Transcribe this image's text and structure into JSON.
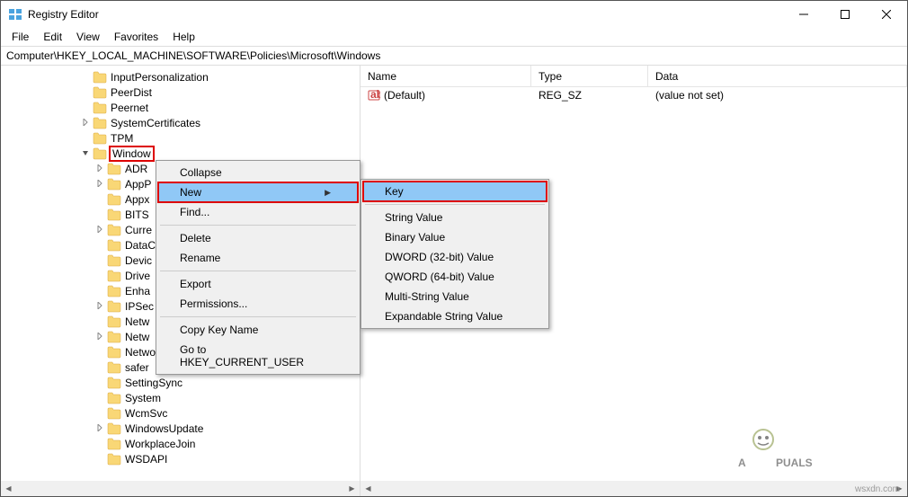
{
  "window": {
    "title": "Registry Editor"
  },
  "menubar": [
    "File",
    "Edit",
    "View",
    "Favorites",
    "Help"
  ],
  "address": "Computer\\HKEY_LOCAL_MACHINE\\SOFTWARE\\Policies\\Microsoft\\Windows",
  "tree": [
    {
      "indent": 88,
      "expander": "",
      "label": "InputPersonalization"
    },
    {
      "indent": 88,
      "expander": "",
      "label": "PeerDist"
    },
    {
      "indent": 88,
      "expander": "",
      "label": "Peernet"
    },
    {
      "indent": 88,
      "expander": ">",
      "label": "SystemCertificates"
    },
    {
      "indent": 88,
      "expander": "",
      "label": "TPM"
    },
    {
      "indent": 88,
      "expander": "v",
      "label": "Window",
      "selected": true,
      "boxed": true
    },
    {
      "indent": 104,
      "expander": ">",
      "label": "ADR"
    },
    {
      "indent": 104,
      "expander": ">",
      "label": "AppP"
    },
    {
      "indent": 104,
      "expander": "",
      "label": "Appx"
    },
    {
      "indent": 104,
      "expander": "",
      "label": "BITS"
    },
    {
      "indent": 104,
      "expander": ">",
      "label": "Curre"
    },
    {
      "indent": 104,
      "expander": "",
      "label": "DataC"
    },
    {
      "indent": 104,
      "expander": "",
      "label": "Devic"
    },
    {
      "indent": 104,
      "expander": "",
      "label": "Drive"
    },
    {
      "indent": 104,
      "expander": "",
      "label": "Enha"
    },
    {
      "indent": 104,
      "expander": ">",
      "label": "IPSec"
    },
    {
      "indent": 104,
      "expander": "",
      "label": "Netw"
    },
    {
      "indent": 104,
      "expander": ">",
      "label": "Netw"
    },
    {
      "indent": 104,
      "expander": "",
      "label": "NetworkProvider"
    },
    {
      "indent": 104,
      "expander": "",
      "label": "safer"
    },
    {
      "indent": 104,
      "expander": "",
      "label": "SettingSync"
    },
    {
      "indent": 104,
      "expander": "",
      "label": "System"
    },
    {
      "indent": 104,
      "expander": "",
      "label": "WcmSvc"
    },
    {
      "indent": 104,
      "expander": ">",
      "label": "WindowsUpdate"
    },
    {
      "indent": 104,
      "expander": "",
      "label": "WorkplaceJoin"
    },
    {
      "indent": 104,
      "expander": "",
      "label": "WSDAPI"
    }
  ],
  "list": {
    "columns": {
      "name": "Name",
      "type": "Type",
      "data": "Data"
    },
    "rows": [
      {
        "name": "(Default)",
        "type": "REG_SZ",
        "data": "(value not set)"
      }
    ]
  },
  "context_menu": {
    "items": [
      {
        "label": "Collapse"
      },
      {
        "label": "New",
        "submenu": true,
        "highlighted": true,
        "boxed": true
      },
      {
        "label": "Find..."
      },
      {
        "sep": true
      },
      {
        "label": "Delete"
      },
      {
        "label": "Rename"
      },
      {
        "sep": true
      },
      {
        "label": "Export"
      },
      {
        "label": "Permissions..."
      },
      {
        "sep": true
      },
      {
        "label": "Copy Key Name"
      },
      {
        "label": "Go to HKEY_CURRENT_USER"
      }
    ],
    "submenu": [
      {
        "label": "Key",
        "highlighted": true,
        "boxed": true
      },
      {
        "sep": true
      },
      {
        "label": "String Value"
      },
      {
        "label": "Binary Value"
      },
      {
        "label": "DWORD (32-bit) Value"
      },
      {
        "label": "QWORD (64-bit) Value"
      },
      {
        "label": "Multi-String Value"
      },
      {
        "label": "Expandable String Value"
      }
    ]
  },
  "watermark": {
    "text": "APPUALS",
    "url": "wsxdn.com"
  }
}
